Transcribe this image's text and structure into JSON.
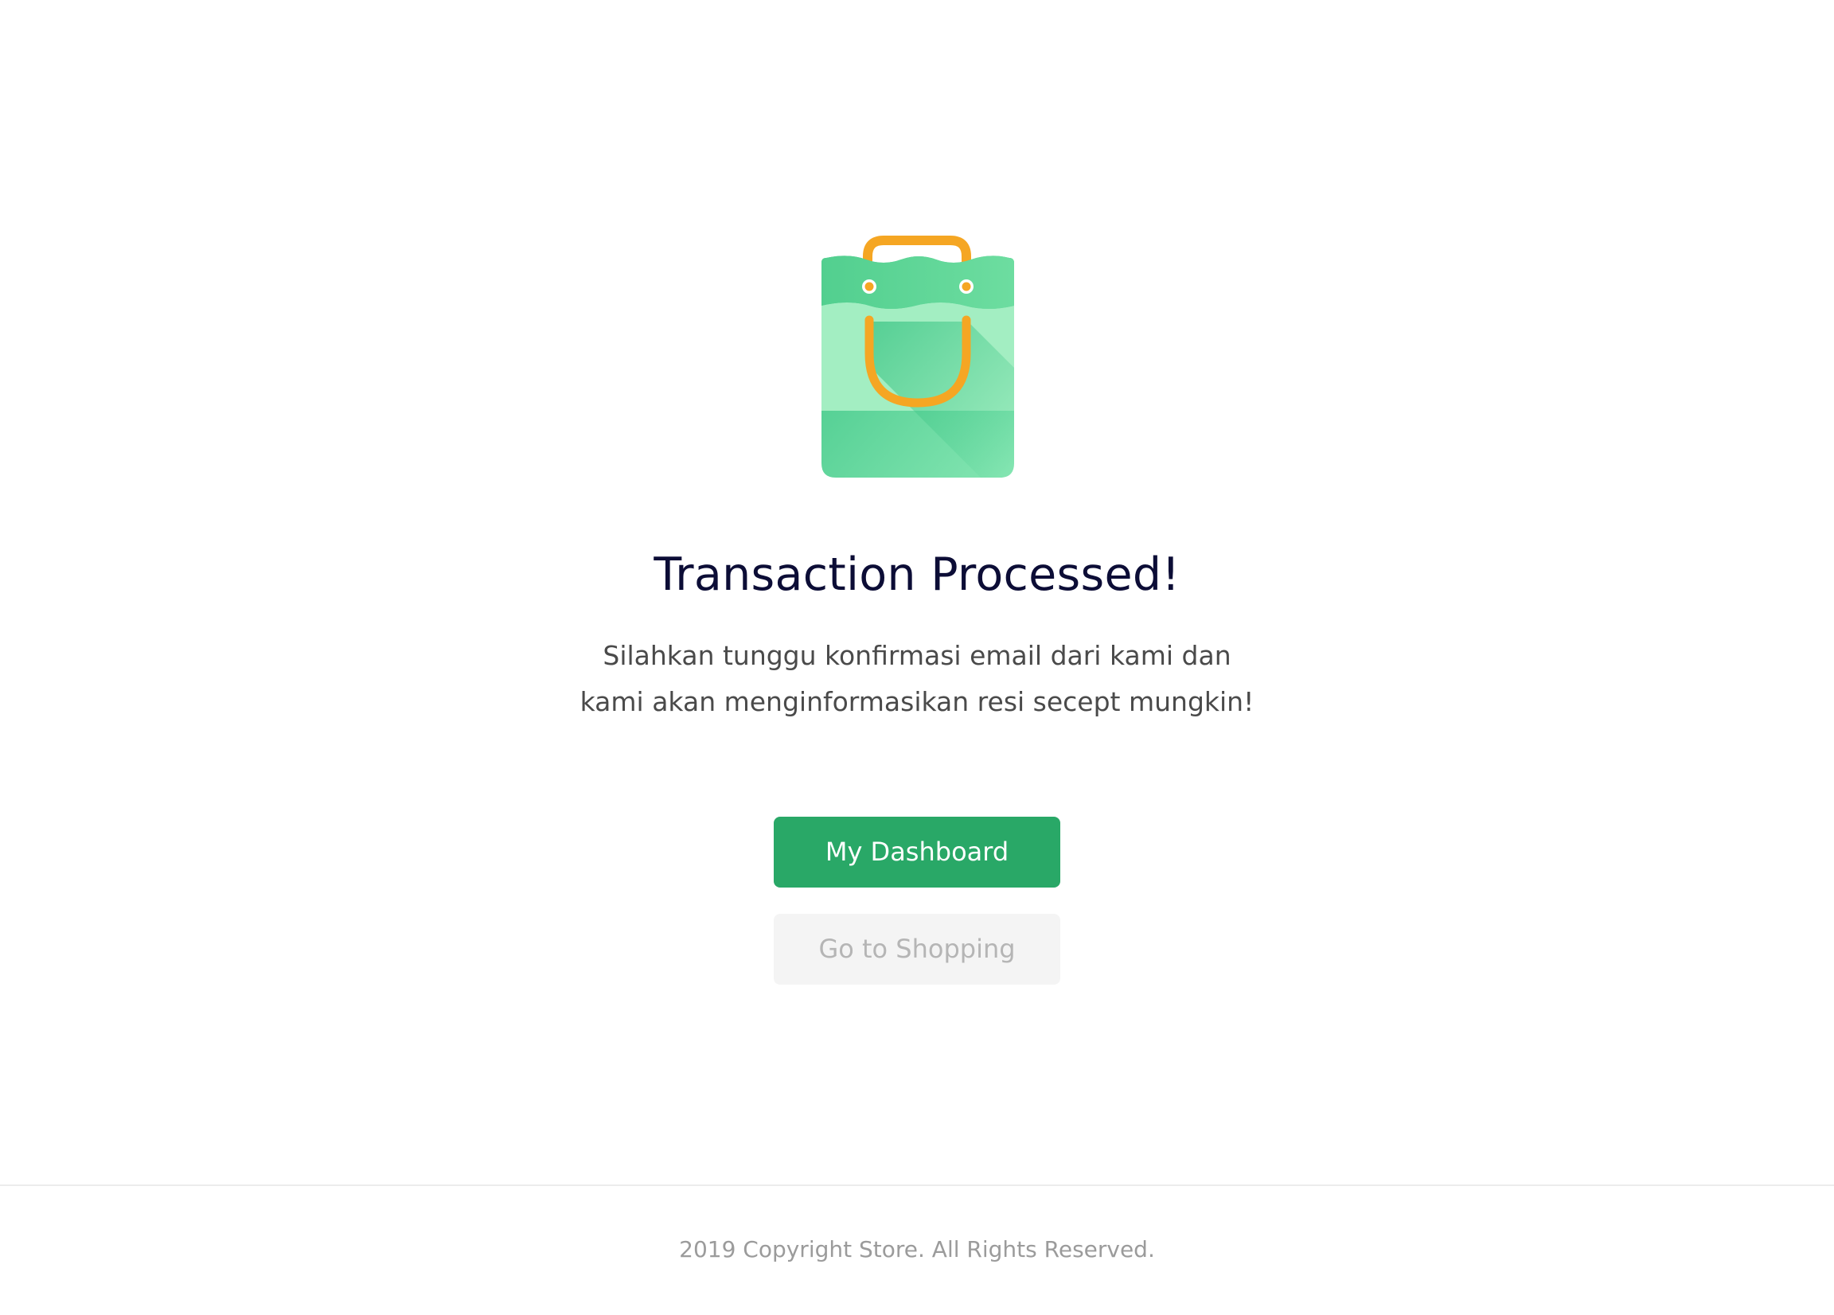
{
  "illustration": {
    "icon": "shopping-bag-icon",
    "colors": {
      "bag_light": "#a3eec2",
      "bag_mid": "#6fdaa0",
      "bag_dark": "#3cc585",
      "handle": "#f5a623"
    }
  },
  "main": {
    "title": "Transaction Processed!",
    "message_line1": "Silahkan tunggu konfirmasi email dari kami dan",
    "message_line2": "kami akan menginformasikan resi secept mungkin!"
  },
  "actions": {
    "dashboard_label": "My Dashboard",
    "shopping_label": "Go to Shopping",
    "primary_color": "#29a867"
  },
  "footer": {
    "copyright": "2019 Copyright Store. All Rights Reserved."
  }
}
